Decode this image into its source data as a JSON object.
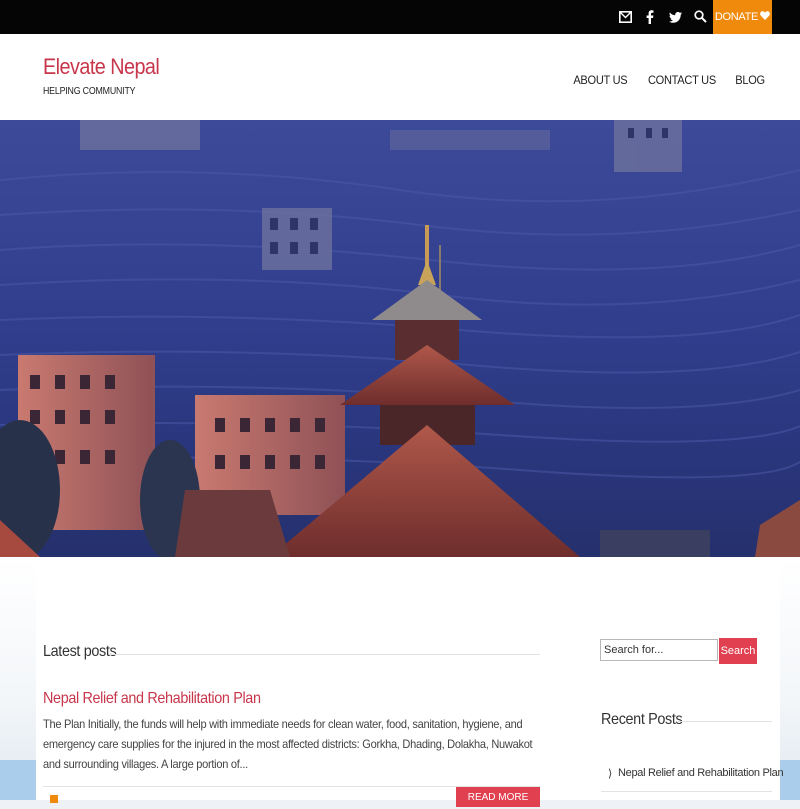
{
  "topbar": {
    "icons": [
      "mail-icon",
      "facebook-icon",
      "twitter-icon",
      "search-icon"
    ],
    "donate_label": "DONATE",
    "donate_icon": "heart-icon",
    "accent": "#f08a0c"
  },
  "header": {
    "site_title": "Elevate Nepal",
    "tagline": "HELPING COMMUNITY",
    "title_color": "#c8364b"
  },
  "nav": {
    "items": [
      "ABOUT US",
      "CONTACT US",
      "BLOG"
    ]
  },
  "main": {
    "latest_heading": "Latest posts",
    "post": {
      "title": "Nepal Relief and Rehabilitation Plan",
      "excerpt": "The Plan Initially, the funds will help with immediate needs for clean water, food, sanitation, hygiene, and emergency care supplies for the injured in the most affected districts: Gorkha, Dhading, Dolakha, Nuwakot and surrounding villages. A large portion of...",
      "read_more_label": "READ MORE"
    }
  },
  "sidebar": {
    "search_placeholder": "Search for...",
    "search_button": "Search",
    "recent_heading": "Recent Posts",
    "recent_items": [
      "Nepal Relief and Rehabilitation Plan"
    ]
  }
}
